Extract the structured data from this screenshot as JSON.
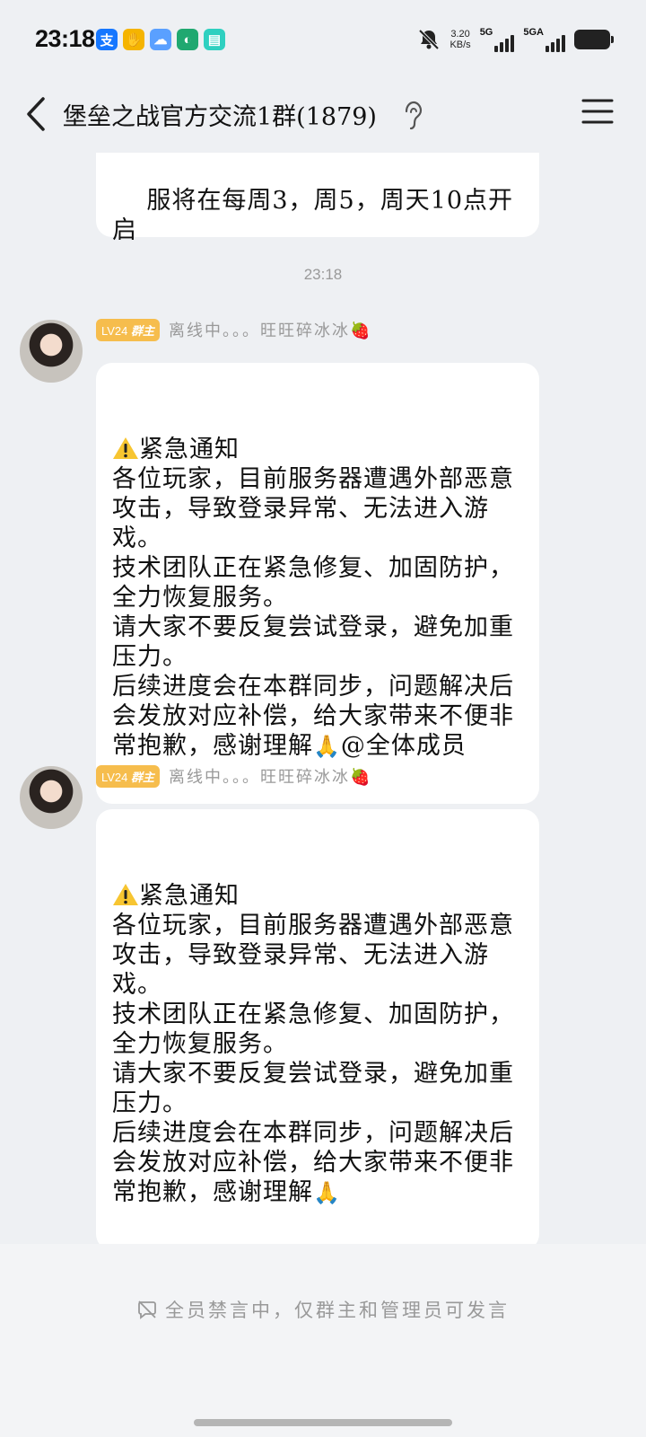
{
  "status_bar": {
    "time": "23:18",
    "app_icons": [
      {
        "name": "alipay-icon",
        "glyph": "支",
        "color": "#1677ff"
      },
      {
        "name": "hand-icon",
        "glyph": "✋",
        "color": "#f5b400"
      },
      {
        "name": "cloud-icon",
        "glyph": "☁",
        "color": "#5aa0ff"
      },
      {
        "name": "circle-app-icon",
        "glyph": "◐",
        "color": "#20a870"
      },
      {
        "name": "message-app-icon",
        "glyph": "▤",
        "color": "#2fd0c0"
      }
    ],
    "speed_value": "3.20",
    "speed_unit": "KB/s",
    "network_1": "5G",
    "network_2": "5GA"
  },
  "header": {
    "title": "堡垒之战官方交流1群(1879)"
  },
  "chat": {
    "partial_message": "服将在每周3，周5，周天10点开启",
    "timestamp": "23:18",
    "messages": [
      {
        "badge_level": "LV24",
        "badge_role": "群主",
        "sender": "离线中。。。旺旺碎冰冰🍓",
        "title": "紧急通知",
        "body": "各位玩家，目前服务器遭遇外部恶意攻击，导致登录异常、无法进入游戏。\n技术团队正在紧急修复、加固防护，全力恢复服务。\n请大家不要反复尝试登录，避免加重压力。\n后续进度会在本群同步，问题解决后会发放对应补偿，给大家带来不便非常抱歉，感谢理解",
        "emoji": "🙏",
        "mention": "@全体成员"
      },
      {
        "badge_level": "LV24",
        "badge_role": "群主",
        "sender": "离线中。。。旺旺碎冰冰🍓",
        "title": "紧急通知",
        "body": "各位玩家，目前服务器遭遇外部恶意攻击，导致登录异常、无法进入游戏。\n技术团队正在紧急修复、加固防护，全力恢复服务。\n请大家不要反复尝试登录，避免加重压力。\n后续进度会在本群同步，问题解决后会发放对应补偿，给大家带来不便非常抱歉，感谢理解",
        "emoji": "🙏",
        "mention": ""
      }
    ]
  },
  "footer": {
    "mute_notice": "全员禁言中，仅群主和管理员可发言"
  }
}
